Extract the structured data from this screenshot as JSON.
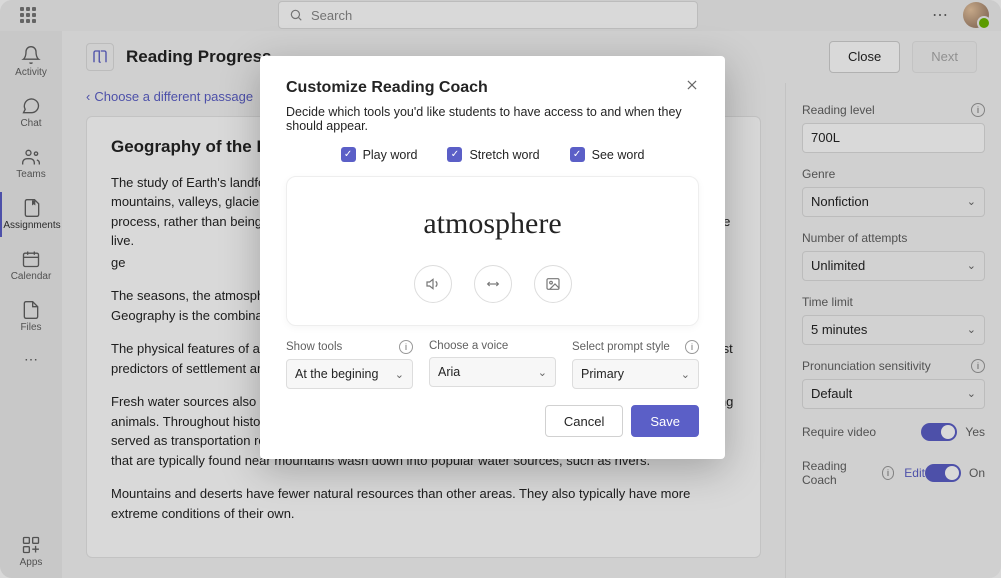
{
  "topbar": {
    "search_placeholder": "Search"
  },
  "rail": {
    "items": [
      {
        "label": "Activity"
      },
      {
        "label": "Chat"
      },
      {
        "label": "Teams"
      },
      {
        "label": "Assignments"
      },
      {
        "label": "Calendar"
      },
      {
        "label": "Files"
      }
    ],
    "apps_label": "Apps"
  },
  "header": {
    "title": "Reading Progress",
    "close_label": "Close",
    "next_label": "Next"
  },
  "back_link": "Choose a different passage",
  "doc": {
    "title": "Geography of the Earth",
    "paragraphs": [
      "The study of Earth's landforms and bodies of water is called physical geography. Landforms include mountains, valleys, glaciers, lakes, or rivers. Landforms are usually areas that developed through a natural process, rather than being man-made. The physical geography of Earth affects how, why, and where people live.",
      "ge",
      "The seasons, the atmosphere and all the natural processes of Earth affect where humans are able to live. Geography is the combination of factors that make Earth livable.",
      "The physical features of a region influence its development. Water and mountain ranges are among the best predictors of settlement areas. In the U.S., the major mountain ranges are in the east and west.",
      "Fresh water sources also influence where people settle. Water can be used for drinking, farming, and raising animals. Throughout history, people have settled along rivers, where they could grow crops. Rivers also served as transportation routes. There was an added bonus, because sometimes the valuable resources that are typically found near mountains wash down into popular water sources, such as rivers.",
      "Mountains and deserts have fewer natural resources than other areas. They also typically have more extreme conditions of their own."
    ]
  },
  "sidebar": {
    "reading_level_label": "Reading level",
    "reading_level_value": "700L",
    "genre_label": "Genre",
    "genre_value": "Nonfiction",
    "attempts_label": "Number of attempts",
    "attempts_value": "Unlimited",
    "time_label": "Time limit",
    "time_value": "5 minutes",
    "pron_label": "Pronunciation sensitivity",
    "pron_value": "Default",
    "require_video_label": "Require video",
    "require_video_value": "Yes",
    "reading_coach_label": "Reading Coach",
    "reading_coach_value": "On",
    "edit_label": "Edit"
  },
  "modal": {
    "title": "Customize Reading Coach",
    "subtitle": "Decide which tools you'd like students to have access to and when they should appear.",
    "check_play": "Play word",
    "check_stretch": "Stretch word",
    "check_see": "See word",
    "preview_word": "atmosphere",
    "show_tools_label": "Show tools",
    "show_tools_value": "At the begining",
    "voice_label": "Choose a voice",
    "voice_value": "Aria",
    "prompt_label": "Select prompt style",
    "prompt_value": "Primary",
    "cancel_label": "Cancel",
    "save_label": "Save"
  }
}
